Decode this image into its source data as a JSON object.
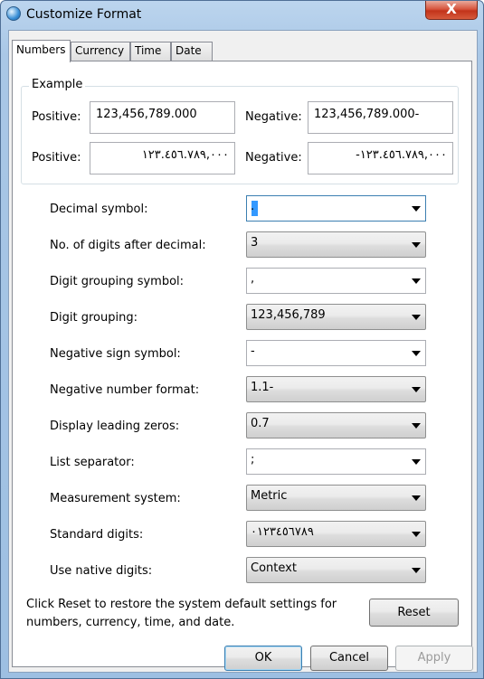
{
  "window": {
    "title": "Customize Format",
    "close_glyph": "X"
  },
  "tabs": [
    {
      "label": "Numbers",
      "active": true
    },
    {
      "label": "Currency",
      "active": false
    },
    {
      "label": "Time",
      "active": false
    },
    {
      "label": "Date",
      "active": false
    }
  ],
  "example": {
    "legend": "Example",
    "positive_label": "Positive:",
    "negative_label": "Negative:",
    "positive_value": "123,456,789.000",
    "negative_value": "123,456,789.000-",
    "positive_native": "١٢٣.٤٥٦.٧٨٩,٠٠٠",
    "negative_native": "-١٢٣.٤٥٦.٧٨٩,٠٠٠"
  },
  "settings": [
    {
      "label": "Decimal symbol:",
      "value": ".",
      "kind": "editable",
      "focused": true
    },
    {
      "label": "No. of digits after decimal:",
      "value": "3",
      "kind": "dropdown"
    },
    {
      "label": "Digit grouping symbol:",
      "value": ",",
      "kind": "editable"
    },
    {
      "label": "Digit grouping:",
      "value": "123,456,789",
      "kind": "dropdown"
    },
    {
      "label": "Negative sign symbol:",
      "value": "-",
      "kind": "editable"
    },
    {
      "label": "Negative number format:",
      "value": "1.1-",
      "kind": "dropdown"
    },
    {
      "label": "Display leading zeros:",
      "value": "0.7",
      "kind": "dropdown"
    },
    {
      "label": "List separator:",
      "value": ";",
      "kind": "editable"
    },
    {
      "label": "Measurement system:",
      "value": "Metric",
      "kind": "dropdown"
    },
    {
      "label": "Standard digits:",
      "value": "٠١٢٣٤٥٦٧٨٩",
      "kind": "dropdown"
    },
    {
      "label": "Use native digits:",
      "value": "Context",
      "kind": "dropdown"
    }
  ],
  "reset": {
    "note_line1": "Click Reset to restore the system default settings for",
    "note_line2": "numbers, currency, time, and date.",
    "button": "Reset"
  },
  "footer": {
    "ok": "OK",
    "cancel": "Cancel",
    "apply": "Apply"
  }
}
